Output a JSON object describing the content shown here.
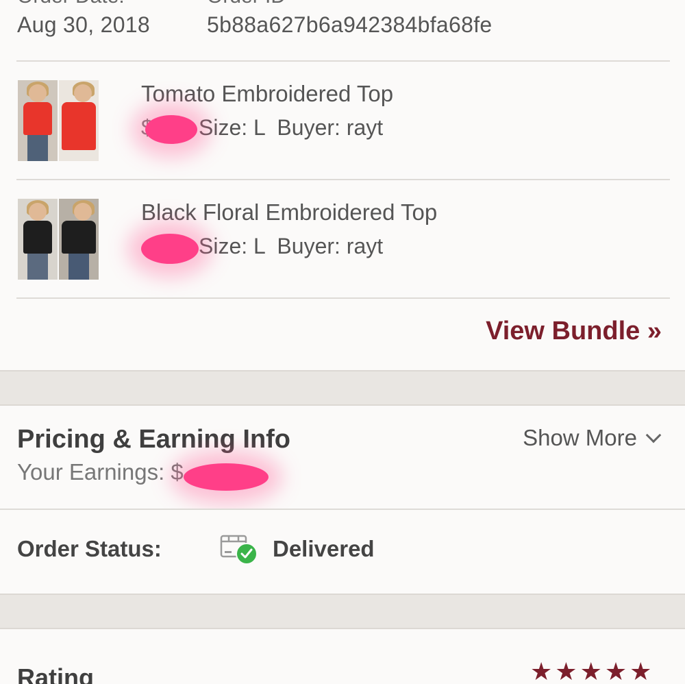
{
  "order": {
    "date_label": "Order Date:",
    "id_label": "Order ID",
    "date": "Aug 30, 2018",
    "id": "5b88a627b6a942384bfa68fe"
  },
  "items": [
    {
      "title": "Tomato Embroidered Top",
      "price_hint": "$",
      "meta": "Size: L  Buyer: rayt",
      "top_color": "#e8352b"
    },
    {
      "title": "Black Floral Embroidered Top",
      "price_hint": "",
      "meta": "Size: L  Buyer: rayt",
      "top_color": "#1e1e1e"
    }
  ],
  "bundle": {
    "label": "View Bundle »"
  },
  "pricing": {
    "title": "Pricing & Earning Info",
    "show_more": "Show More",
    "earnings_label": "Your Earnings: $"
  },
  "status": {
    "label": "Order Status:",
    "value": "Delivered",
    "icon": "delivered-box-icon"
  },
  "rating": {
    "title": "Rating",
    "stars": 5
  },
  "colors": {
    "accent": "#7c1f2c",
    "redaction": "#ff3f88",
    "check": "#3bb44a"
  }
}
